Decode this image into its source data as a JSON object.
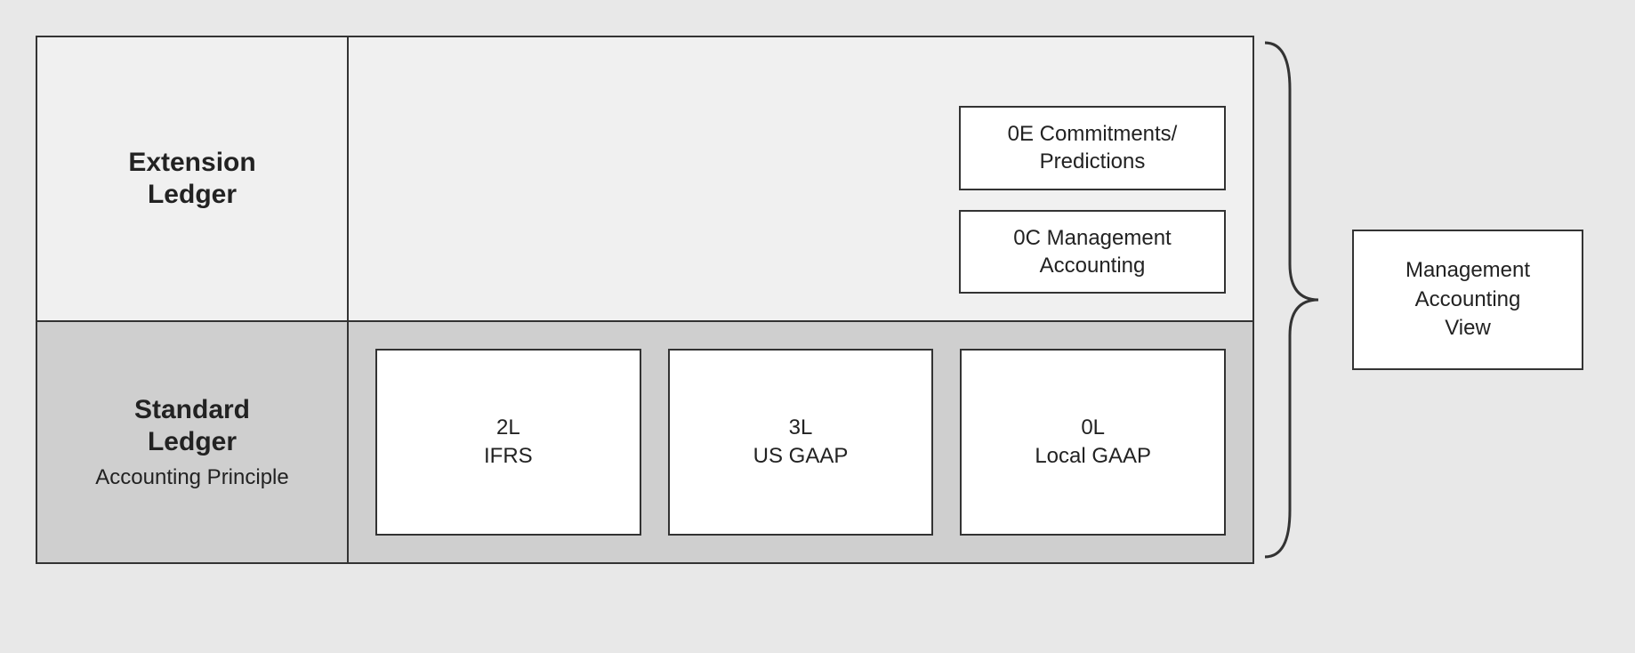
{
  "extension": {
    "title_l1": "Extension",
    "title_l2": "Ledger",
    "box1_l1": "0E Commitments/",
    "box1_l2": "Predictions",
    "box2_l1": "0C Management",
    "box2_l2": "Accounting"
  },
  "standard": {
    "title_l1": "Standard",
    "title_l2": "Ledger",
    "subtitle": "Accounting Principle",
    "boxes": [
      {
        "code": "2L",
        "name": "IFRS"
      },
      {
        "code": "3L",
        "name": "US GAAP"
      },
      {
        "code": "0L",
        "name": "Local GAAP"
      }
    ]
  },
  "mview": {
    "l1": "Management",
    "l2": "Accounting",
    "l3": "View"
  }
}
